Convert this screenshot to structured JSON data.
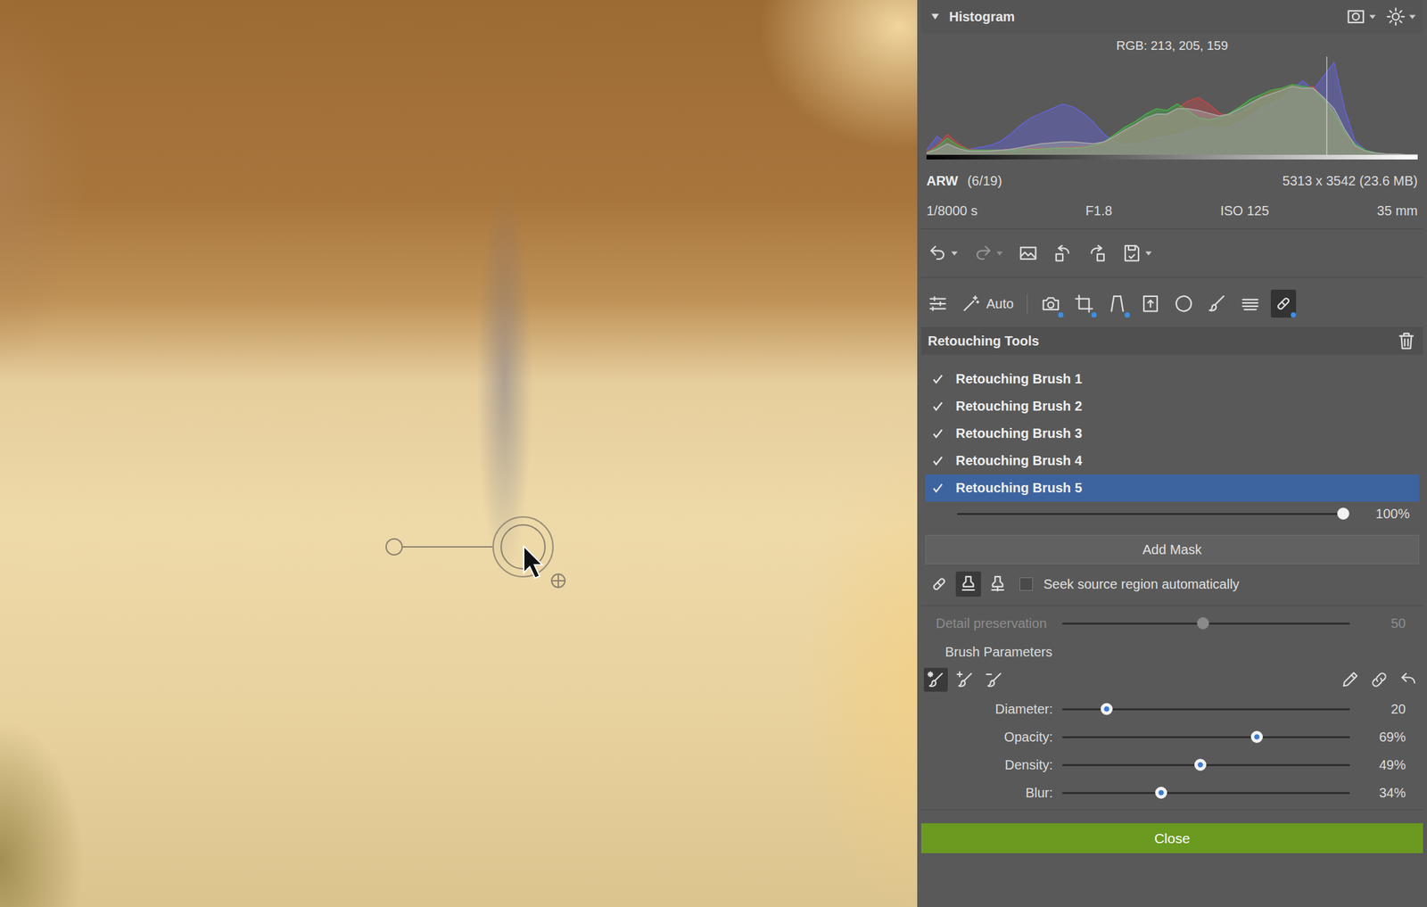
{
  "histogram": {
    "title": "Histogram",
    "expanded": true,
    "reading": "RGB: 213, 205, 159",
    "marker_level": 0.815,
    "header_icons": [
      {
        "kind": "mask",
        "dropdown": true
      },
      {
        "kind": "sun",
        "dropdown": true
      }
    ],
    "series": [
      {
        "name": "blue",
        "color": "#6464d2",
        "values": [
          0.05,
          0.2,
          0.12,
          0.05,
          0.06,
          0.08,
          0.1,
          0.14,
          0.22,
          0.32,
          0.4,
          0.45,
          0.5,
          0.55,
          0.52,
          0.45,
          0.35,
          0.22,
          0.14,
          0.1,
          0.12,
          0.15,
          0.18,
          0.2,
          0.22,
          0.25,
          0.3,
          0.3,
          0.28,
          0.3,
          0.35,
          0.42,
          0.5,
          0.55,
          0.6,
          0.72,
          0.8,
          0.7,
          0.85,
          1.0,
          0.5,
          0.15,
          0.05,
          0.02,
          0.01,
          0.01,
          0.0,
          0.0
        ]
      },
      {
        "name": "red",
        "color": "#c44848",
        "values": [
          0.03,
          0.1,
          0.22,
          0.12,
          0.06,
          0.05,
          0.05,
          0.05,
          0.06,
          0.06,
          0.07,
          0.07,
          0.07,
          0.08,
          0.08,
          0.09,
          0.1,
          0.12,
          0.18,
          0.25,
          0.32,
          0.38,
          0.4,
          0.42,
          0.5,
          0.58,
          0.62,
          0.55,
          0.45,
          0.42,
          0.45,
          0.52,
          0.62,
          0.68,
          0.72,
          0.75,
          0.72,
          0.74,
          0.6,
          0.45,
          0.25,
          0.1,
          0.04,
          0.02,
          0.01,
          0.01,
          0.0,
          0.0
        ]
      },
      {
        "name": "green",
        "color": "#48b048",
        "values": [
          0.02,
          0.08,
          0.18,
          0.1,
          0.05,
          0.05,
          0.05,
          0.05,
          0.05,
          0.06,
          0.06,
          0.06,
          0.07,
          0.07,
          0.07,
          0.08,
          0.1,
          0.14,
          0.22,
          0.3,
          0.36,
          0.44,
          0.5,
          0.48,
          0.55,
          0.48,
          0.4,
          0.38,
          0.4,
          0.45,
          0.52,
          0.6,
          0.65,
          0.7,
          0.72,
          0.76,
          0.74,
          0.72,
          0.6,
          0.45,
          0.25,
          0.12,
          0.05,
          0.02,
          0.01,
          0.01,
          0.0,
          0.0
        ]
      },
      {
        "name": "luminance",
        "color": "#a8a8a8",
        "values": [
          0.02,
          0.06,
          0.12,
          0.07,
          0.04,
          0.04,
          0.04,
          0.05,
          0.06,
          0.08,
          0.1,
          0.12,
          0.13,
          0.14,
          0.14,
          0.13,
          0.12,
          0.14,
          0.2,
          0.27,
          0.33,
          0.4,
          0.44,
          0.44,
          0.5,
          0.5,
          0.48,
          0.45,
          0.42,
          0.44,
          0.5,
          0.56,
          0.62,
          0.66,
          0.7,
          0.74,
          0.72,
          0.72,
          0.62,
          0.5,
          0.28,
          0.1,
          0.04,
          0.02,
          0.01,
          0.01,
          0.0,
          0.0
        ]
      }
    ]
  },
  "file_info": {
    "format": "ARW",
    "index": "(6/19)",
    "dimensions": "5313 x 3542 (23.6 MB)",
    "shutter": "1/8000 s",
    "aperture": "F1.8",
    "iso": "ISO 125",
    "focal": "35 mm"
  },
  "actions": [
    {
      "kind": "undo",
      "disabled": false,
      "dropdown": true
    },
    {
      "kind": "redo",
      "disabled": true,
      "dropdown": true
    },
    {
      "kind": "picture",
      "disabled": false,
      "dropdown": false
    },
    {
      "kind": "rotate_left",
      "disabled": false,
      "dropdown": false
    },
    {
      "kind": "rotate_right",
      "disabled": false,
      "dropdown": false
    },
    {
      "kind": "save",
      "disabled": false,
      "dropdown": true
    }
  ],
  "tools": {
    "primary": [
      {
        "kind": "sliders",
        "selected": false,
        "modified": false
      },
      {
        "kind": "wand",
        "label": "Auto",
        "selected": false,
        "modified": false
      }
    ],
    "edit": [
      {
        "kind": "camera",
        "selected": false,
        "modified": true
      },
      {
        "kind": "crop",
        "selected": false,
        "modified": true
      },
      {
        "kind": "perspective",
        "selected": false,
        "modified": true
      },
      {
        "kind": "frame",
        "selected": false,
        "modified": false
      },
      {
        "kind": "vignette",
        "selected": false,
        "modified": false
      },
      {
        "kind": "brush",
        "selected": false,
        "modified": false
      },
      {
        "kind": "gradient",
        "selected": false,
        "modified": false
      },
      {
        "kind": "retouch",
        "selected": true,
        "modified": true
      }
    ]
  },
  "retouching": {
    "title": "Retouching Tools",
    "brushes": [
      {
        "label": "Retouching Brush 1",
        "checked": true,
        "selected": false
      },
      {
        "label": "Retouching Brush 2",
        "checked": true,
        "selected": false
      },
      {
        "label": "Retouching Brush 3",
        "checked": true,
        "selected": false
      },
      {
        "label": "Retouching Brush 4",
        "checked": true,
        "selected": false
      },
      {
        "label": "Retouching Brush 5",
        "checked": true,
        "selected": true
      }
    ],
    "strength": {
      "level": 1.0,
      "reading": "100%"
    },
    "add_mask": "Add Mask",
    "modes": [
      {
        "kind": "heal",
        "selected": false
      },
      {
        "kind": "clone",
        "selected": true
      },
      {
        "kind": "stamp",
        "selected": false
      }
    ],
    "seek_auto": {
      "label": "Seek source region automatically",
      "checked": false
    },
    "detail": {
      "label": "Detail preservation",
      "level": 0.49,
      "reading": "50",
      "disabled": true
    }
  },
  "brush_params": {
    "title": "Brush Parameters",
    "modes": [
      {
        "kind": "paint",
        "selected": true
      },
      {
        "kind": "add",
        "selected": false
      },
      {
        "kind": "erase",
        "selected": false
      }
    ],
    "extras": [
      {
        "kind": "pick"
      },
      {
        "kind": "link"
      },
      {
        "kind": "reset"
      }
    ],
    "sliders": [
      {
        "label": "Diameter:",
        "level": 0.155,
        "reading": "20"
      },
      {
        "label": "Opacity:",
        "level": 0.677,
        "reading": "69%"
      },
      {
        "label": "Density:",
        "level": 0.48,
        "reading": "49%"
      },
      {
        "label": "Blur:",
        "level": 0.345,
        "reading": "34%"
      }
    ]
  },
  "close": "Close"
}
